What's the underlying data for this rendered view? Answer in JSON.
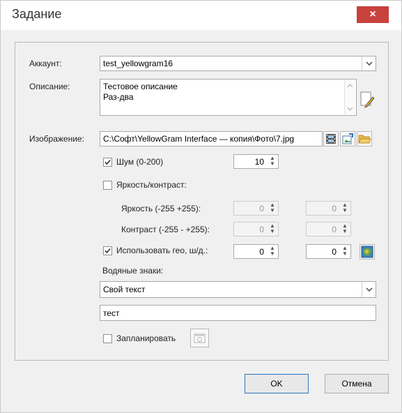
{
  "window": {
    "title": "Задание",
    "close_glyph": "×"
  },
  "form": {
    "account_label": "Аккаунт:",
    "account_value": "test_yellowgram16",
    "description_label": "Описание:",
    "description_lines": [
      "Тестовое описание",
      "Раз-два"
    ],
    "image_label": "Изображение:",
    "image_path": "C:\\Софт\\YellowGram Interface — копия\\Фото\\7.jpg",
    "noise_label": "Шум (0-200)",
    "noise_checked": true,
    "noise_value": "10",
    "brightness_contrast_label": "Яркость/контраст:",
    "brightness_contrast_checked": false,
    "brightness_label": "Яркость (-255 +255):",
    "brightness_value_1": "0",
    "brightness_value_2": "0",
    "contrast_label": "Контраст (-255 - +255):",
    "contrast_value_1": "0",
    "contrast_value_2": "0",
    "geo_label": "Использовать гео, ш/д.:",
    "geo_checked": true,
    "geo_lat": "0",
    "geo_lon": "0",
    "watermark_label": "Водяные знаки:",
    "watermark_type": "Свой текст",
    "watermark_text": "тест",
    "schedule_label": "Запланировать",
    "schedule_checked": false
  },
  "buttons": {
    "ok": "OK",
    "cancel": "Отмена"
  },
  "colors": {
    "close": "#c8413d",
    "default_border": "#2a75bf"
  },
  "icons": [
    "chevron-down-icon",
    "edit-icon",
    "film-icon",
    "image-edit-icon",
    "folder-icon",
    "globe-icon",
    "calendar-icon"
  ]
}
